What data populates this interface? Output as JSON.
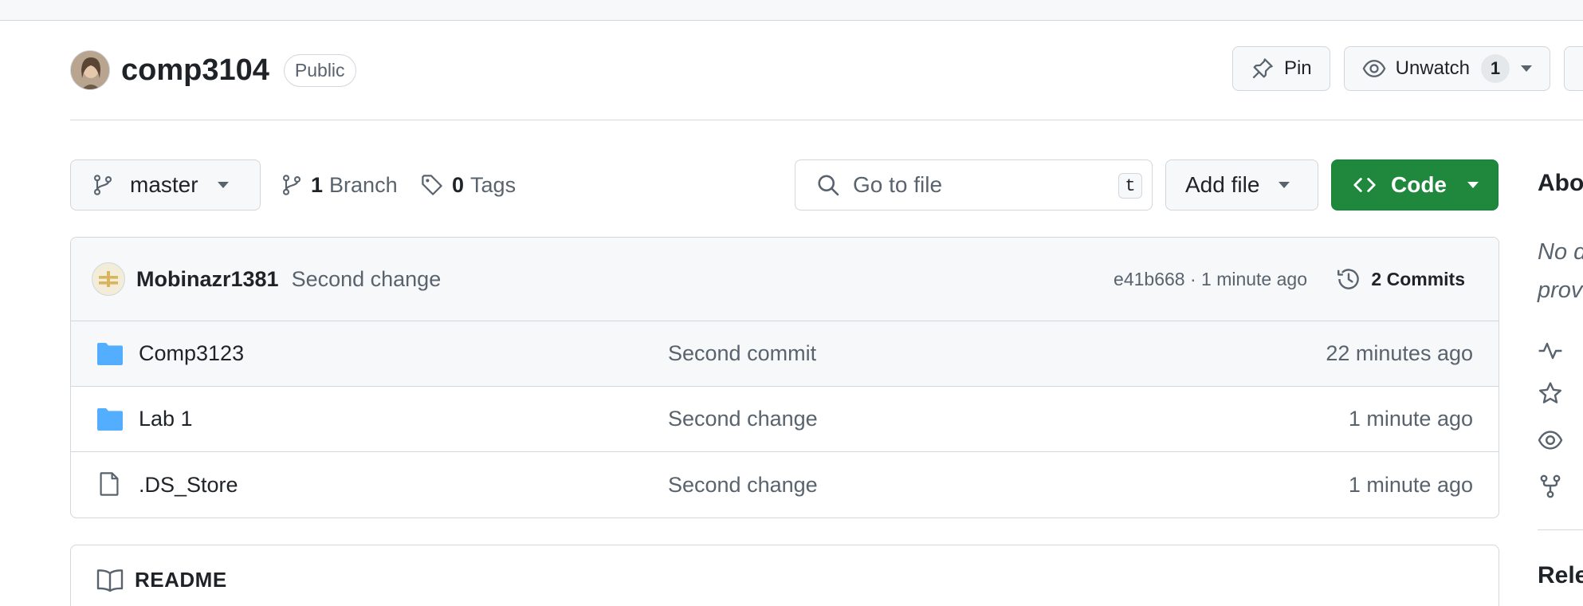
{
  "repo": {
    "name": "comp3104",
    "visibility": "Public"
  },
  "header_actions": {
    "pin_label": "Pin",
    "watch_label": "Unwatch",
    "watch_count": "1"
  },
  "toolbar": {
    "branch": "master",
    "branch_count": "1",
    "branch_label": "Branch",
    "tag_count": "0",
    "tag_label": "Tags",
    "search_placeholder": "Go to file",
    "search_shortcut": "t",
    "add_file_label": "Add file",
    "code_label": "Code"
  },
  "latest_commit": {
    "author": "Mobinazr1381",
    "message": "Second change",
    "hash_time": "e41b668 · 1 minute ago",
    "commits_label": "2 Commits"
  },
  "files": [
    {
      "name": "Comp3123",
      "type": "folder",
      "commit": "Second commit",
      "time": "22 minutes ago"
    },
    {
      "name": "Lab 1",
      "type": "folder",
      "commit": "Second change",
      "time": "1 minute ago"
    },
    {
      "name": ".DS_Store",
      "type": "file",
      "commit": "Second change",
      "time": "1 minute ago"
    }
  ],
  "readme": {
    "label": "README"
  },
  "sidebar": {
    "about_title": "Abo",
    "desc_line1": "No d",
    "desc_line2": "prov",
    "releases_title": "Rele"
  },
  "colors": {
    "accent_green": "#1f883d",
    "folder_blue": "#54aeff",
    "muted_text": "#59636e",
    "border": "#d0d7de"
  }
}
